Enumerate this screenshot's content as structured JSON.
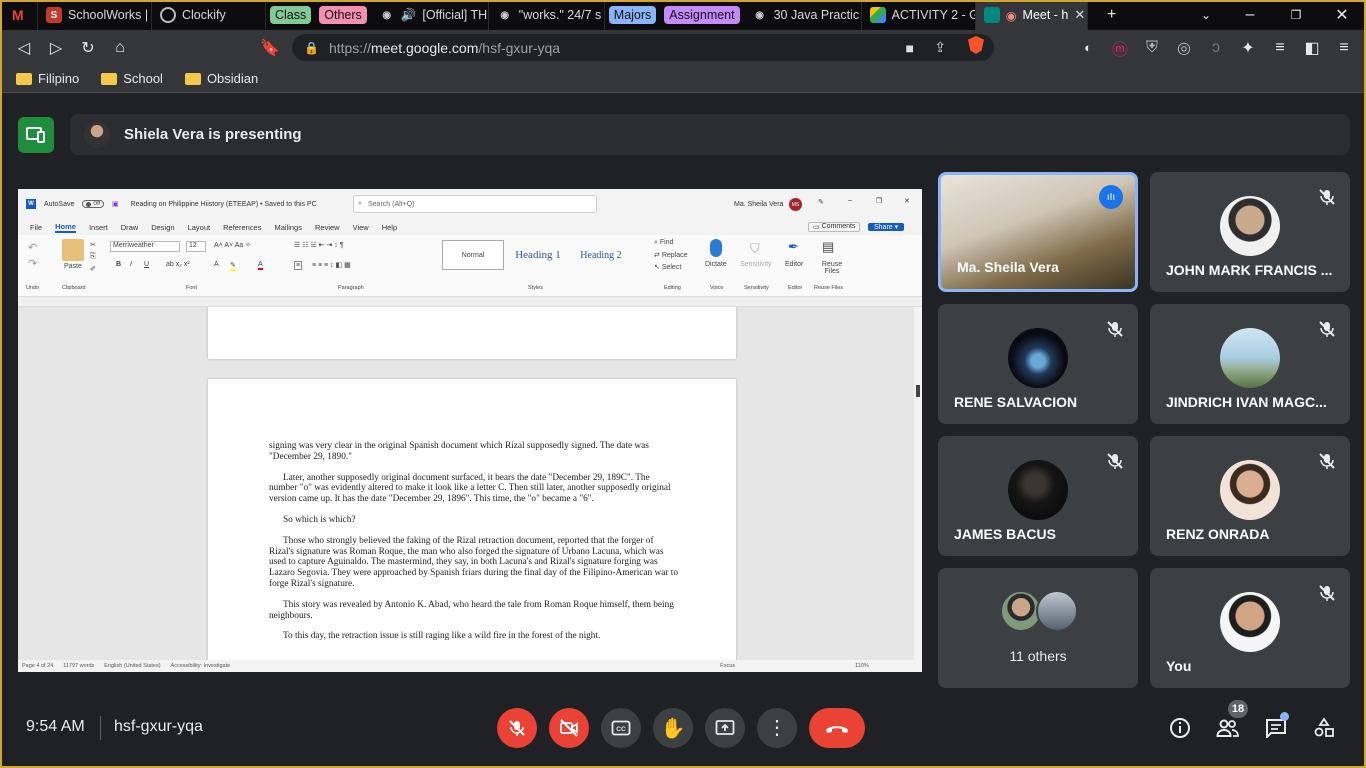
{
  "browser": {
    "tabs": [
      {
        "title": "SchoolWorks |",
        "icon": "schoolworks-icon"
      },
      {
        "title": "Clockify",
        "icon": "clockify-icon"
      },
      {
        "title": "[Official] TH",
        "icon": "audio-icon"
      },
      {
        "title": "\"works.\" 24/7 s",
        "icon": "globe-icon"
      },
      {
        "title": "30 Java Practic",
        "icon": "globe-icon"
      },
      {
        "title": "ACTIVITY 2 - G",
        "icon": "drive-icon"
      },
      {
        "title": "Meet - h",
        "icon": "meet-icon"
      }
    ],
    "groups": [
      {
        "label": "Class",
        "color": "#81c995"
      },
      {
        "label": "Others",
        "color": "#f48fb1"
      },
      {
        "label": "Majors",
        "color": "#8ab4f8"
      },
      {
        "label": "Assignment",
        "color": "#c58af9"
      }
    ],
    "url_scheme": "https://",
    "url_host": "meet.google.com",
    "url_path": "/hsf-gxur-yqa",
    "bookmarks": [
      "Filipino",
      "School",
      "Obsidian"
    ]
  },
  "meet": {
    "presenting_text": "Shiela Vera is presenting",
    "time": "9:54 AM",
    "meeting_code": "hsf-gxur-yqa",
    "participant_count": "18",
    "others_label": "11 others",
    "participants": [
      {
        "name": "Ma. Sheila Vera",
        "speaking": true
      },
      {
        "name": "JOHN MARK FRANCIS ...",
        "muted": true
      },
      {
        "name": "RENE SALVACION",
        "muted": true
      },
      {
        "name": "JINDRICH IVAN MAGC...",
        "muted": true
      },
      {
        "name": "JAMES BACUS",
        "muted": true
      },
      {
        "name": "RENZ ONRADA",
        "muted": true
      },
      {
        "name": "You",
        "muted": true
      }
    ]
  },
  "word": {
    "autosave": "AutoSave",
    "autosave_state": "Off",
    "doc_title": "Reading on Philippine Hiistory (ETEEAP) • Saved to this PC",
    "search_placeholder": "Search (Alt+Q)",
    "user": "Ma. Sheila Vera",
    "user_initials": "MS",
    "tabs": [
      "File",
      "Home",
      "Insert",
      "Draw",
      "Design",
      "Layout",
      "References",
      "Mailings",
      "Review",
      "View",
      "Help"
    ],
    "comments_label": "Comments",
    "share_label": "Share",
    "font_name": "Merriweather",
    "font_size": "12",
    "styles": [
      "Normal",
      "Heading 1",
      "Heading 2"
    ],
    "editing": [
      "Find",
      "Replace",
      "Select"
    ],
    "ribbon_groups": [
      "Undo",
      "Clipboard",
      "Font",
      "Paragraph",
      "Styles",
      "Editing",
      "Voice",
      "Sensitivity",
      "Editor",
      "Reuse Files"
    ],
    "ribbon_buttons": [
      "Paste",
      "Dictate",
      "Sensitivity",
      "Editor",
      "Reuse Files"
    ],
    "status": [
      "Page 4 of 24",
      "11797 words",
      "English (United States)",
      "Accessibility: Investigate",
      "Focus",
      "110%"
    ],
    "paragraphs": [
      "signing was very clear in the original Spanish document which Rizal supposedly signed. The date was \"December 29, 1890.\"",
      "Later, another supposedly original document surfaced, it bears the date \"December 29, 189C\". The number \"o\" was evidently altered to make it look like a letter C. Then still later, another supposedly original version came up. It has the date \"December 29, 1896\". This time, the \"o\" became a \"6\".",
      "So which is which?",
      "Those who strongly believed the faking of the Rizal retraction document, reported that the forger of Rizal's signature was Roman Roque, the man who also forged the signature of Urbano Lacuna, which was used to capture Aguinaldo. The mastermind, they say, in both Lacuna's and Rizal's signature forging was Lazaro Segovia. They were approached by Spanish friars during the final day of the Filipino-American war to forge Rizal's signature.",
      "This story was revealed by Antonio K. Abad, who heard the tale from Roman Roque himself, them being neighbours.",
      "To this day, the retraction issue is still raging like a wild fire in the forest of the night."
    ]
  }
}
